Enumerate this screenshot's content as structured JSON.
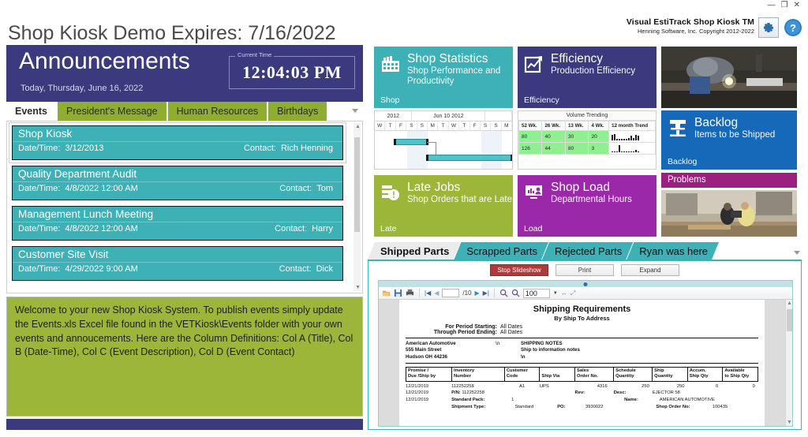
{
  "window": {
    "minimize": "—",
    "restore": "❐",
    "close": "✕"
  },
  "brand": {
    "title": "Visual EstiTrack Shop Kiosk TM",
    "subtitle": "Henning Software, Inc.  Copyright 2012-2022",
    "settings_icon": "gear-icon",
    "help_icon": "help-icon"
  },
  "page_title": "Shop Kiosk Demo Expires: 7/16/2022",
  "announcements": {
    "heading": "Announcements",
    "date_line": "Today, Thursday, June 16, 2022",
    "clock_label": "Current Time",
    "clock_time": "12:04:03 PM",
    "tabs": [
      {
        "label": "Events",
        "active": true
      },
      {
        "label": "President's Message",
        "active": false
      },
      {
        "label": "Human Resources",
        "active": false
      },
      {
        "label": "Birthdays",
        "active": false
      }
    ],
    "events": [
      {
        "title": "Shop Kiosk",
        "date_label": "Date/Time:",
        "date_value": "3/12/2013",
        "contact_label": "Contact:",
        "contact_value": "Rich Henning",
        "selected": true
      },
      {
        "title": "Quality Department Audit",
        "date_label": "Date/Time:",
        "date_value": "4/8/2022 12:00 AM",
        "contact_label": "Contact:",
        "contact_value": "Tom",
        "selected": false
      },
      {
        "title": "Management Lunch Meeting",
        "date_label": "Date/Time:",
        "date_value": "4/8/2022 12:00 AM",
        "contact_label": "Contact:",
        "contact_value": "Harry",
        "selected": false
      },
      {
        "title": "Customer Site Visit",
        "date_label": "Date/Time:",
        "date_value": "4/29/2022 9:00 AM",
        "contact_label": "Contact:",
        "contact_value": "Dick",
        "selected": false
      }
    ],
    "welcome_text": "Welcome to your new Shop Kiosk System.  To publish events simply update the Events.xls Excel file found in the VETKiosk\\Events folder with your own events and annoucements.  Here are the Column Definitions: Col A (Title), Col B (Date-Time), Col C (Event Description), Col D (Event Contact)"
  },
  "tiles": [
    {
      "name": "Shop Statistics",
      "sub": "Shop Performance and Productivity",
      "foot": "Shop",
      "color": "#3eb1b7",
      "icon": "factory-icon"
    },
    {
      "name": "Efficiency",
      "sub": "Production Efficiency",
      "foot": "Efficiency",
      "color": "#3b3a7e",
      "icon": "chart-up-icon"
    },
    {
      "name": "Backlog",
      "sub": "Items to be Shipped",
      "foot": "Backlog",
      "color": "#1668b8",
      "icon": "press-icon"
    },
    {
      "name": "Late Jobs",
      "sub": "Shop Orders that are Late",
      "foot": "Late",
      "color": "#9cb63a",
      "icon": "alert-list-icon"
    },
    {
      "name": "Shop Load",
      "sub": "Departmental Hours",
      "foot": "Load",
      "color": "#9b28a8",
      "icon": "monitor-chart-icon"
    },
    {
      "name": "Problems",
      "sub": "",
      "foot": "",
      "color": "#9b2080",
      "icon": "problems-icon"
    }
  ],
  "gantt": {
    "header_left": "2012",
    "header_center": "Jun 10 2012",
    "days": [
      "W",
      "T",
      "F",
      "S",
      "S",
      "M",
      "T",
      "W",
      "T",
      "F",
      "S",
      "S",
      "M"
    ]
  },
  "volume_trending": {
    "title": "Volume Trending",
    "columns": [
      "52 Wk.",
      "26 Wk.",
      "13 Wk.",
      "4 Wk.",
      "12 month Trend"
    ],
    "rows": [
      {
        "values": [
          "80",
          "40",
          "30",
          "20"
        ],
        "spark": [
          7,
          8,
          2,
          2,
          2,
          2,
          2,
          3,
          6,
          3,
          7,
          6
        ]
      },
      {
        "values": [
          "126",
          "44",
          "80",
          "3"
        ],
        "spark": [
          1,
          1,
          1,
          9,
          1,
          1,
          1,
          1,
          1,
          1,
          3,
          1
        ]
      }
    ]
  },
  "doc_panel": {
    "tabs": [
      {
        "label": "Shipped Parts",
        "active": true
      },
      {
        "label": "Scrapped Parts",
        "active": false
      },
      {
        "label": "Rejected Parts",
        "active": false
      },
      {
        "label": "Ryan was here",
        "active": false
      }
    ],
    "buttons": [
      {
        "label": "Stop Slideshow",
        "kind": "stop"
      },
      {
        "label": "Print",
        "kind": "normal"
      },
      {
        "label": "Expand",
        "kind": "normal"
      }
    ],
    "viewer_toolbar": {
      "open_icon": "open-folder-icon",
      "save_icon": "save-icon",
      "print_icon": "print-icon",
      "first_icon": "first-page-icon",
      "prev_icon": "previous-page-icon",
      "page_value": "",
      "page_total": "/10",
      "next_icon": "next-page-icon",
      "last_icon": "last-page-icon",
      "zoom_in_icon": "zoom-in-icon",
      "zoom_out_icon": "zoom-out-icon",
      "zoom_value": "100",
      "fit_width_icon": "fit-width-icon",
      "fit_page_icon": "fit-page-icon"
    }
  },
  "report": {
    "title": "Shipping Requirements",
    "subtitle": "By Ship To Address",
    "period_start_label": "For Period Starting:",
    "period_start_value": "All Dates",
    "period_end_label": "Through Period Ending:",
    "period_end_value": "All Dates",
    "address": [
      "American Automotive",
      "555 Main Street",
      "Hudson  OH 44236"
    ],
    "address_marker": "\\n",
    "notes_title": "SHIPPING NOTES",
    "notes_line": "Ship to information notes",
    "notes_marker": "\\n",
    "columns": [
      "Promise /|Due /Ship by",
      "Inventory|Number",
      "Customer|Code",
      "|Ship Via",
      "Sales|Order No.",
      "Schedule|Quantity",
      "Ship|Quantity",
      "Accum.|Ship Qty",
      "Available|to Ship Qty"
    ],
    "row1": {
      "date": "12/21/2019",
      "inventory": "112252258",
      "customer_code": "A1",
      "ship_via": "UPS",
      "sales_order": "4316",
      "schedule_qty": "250",
      "ship_qty": "250",
      "accum_qty": "0",
      "available_qty": "0"
    },
    "row2": {
      "date": "12/21/2019",
      "pn_label": "P/N:",
      "pn_value": "112252258",
      "rev_label": "Rev:",
      "desc_label": "Desc:",
      "desc_value": "EJECTOR 58"
    },
    "row3": {
      "date": "12/21/2019",
      "pack_label": "Standard Pack:",
      "pack_value": "1",
      "name_label": "Name:",
      "name_value": "AMERICAN AUTOMOTIVE"
    },
    "row4": {
      "ship_type_label": "Shipment Type:",
      "ship_type_value": "Standard",
      "po_label": "PO:",
      "po_value": "3930022",
      "so_label": "Shop Order No:",
      "so_value": "100435"
    }
  }
}
